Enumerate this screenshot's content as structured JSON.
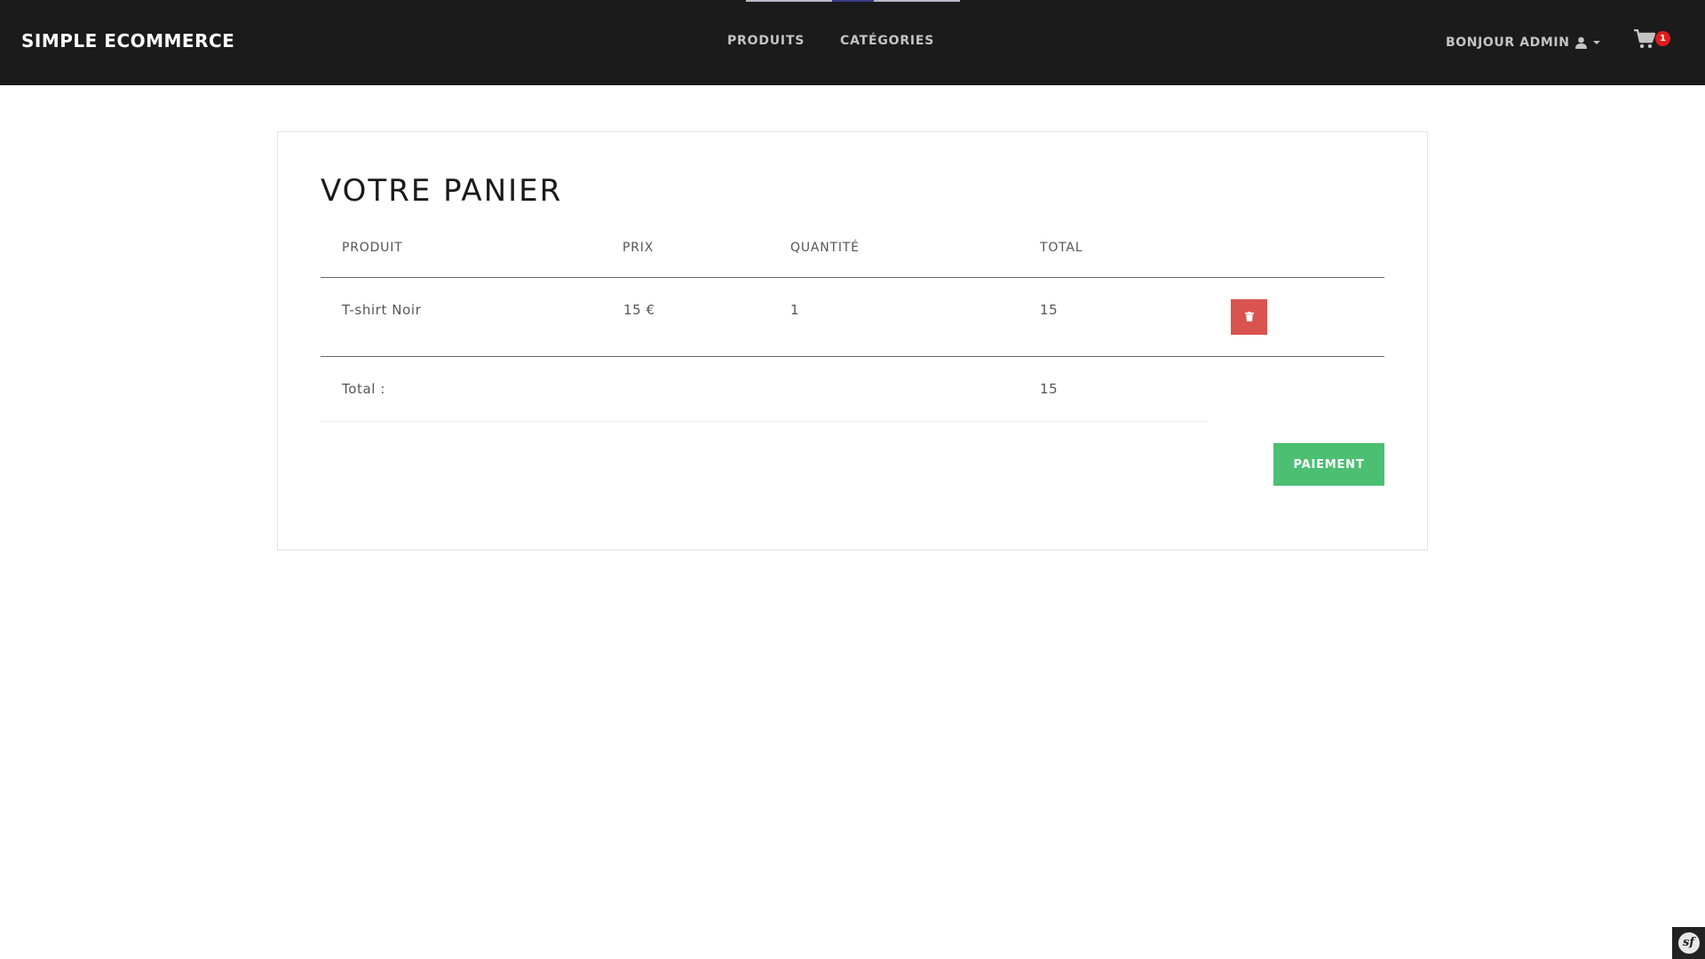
{
  "navbar": {
    "brand": "SIMPLE ECOMMERCE",
    "links": [
      "PRODUITS",
      "CATÉGORIES"
    ],
    "user_greeting": "BONJOUR ADMIN",
    "user_icon": "user-icon",
    "caret_icon": "caret-down-icon",
    "cart_icon": "cart-icon",
    "cart_count": "1"
  },
  "cart": {
    "title": "VOTRE PANIER",
    "columns": [
      "PRODUIT",
      "PRIX",
      "QUANTITÉ",
      "TOTAL"
    ],
    "rows": [
      {
        "product": "T-shirt Noir",
        "price": "15 €",
        "quantity": "1",
        "total": "15",
        "delete_icon": "trash-icon"
      }
    ],
    "total_label": "Total :",
    "total_value": "15",
    "checkout_label": "PAIEMENT"
  },
  "debug_toolbar": {
    "label": "sf"
  },
  "colors": {
    "navbar_bg": "#1b1b1b",
    "delete": "#d9534f",
    "checkout": "#4cbf73",
    "badge": "#e21a1a"
  }
}
